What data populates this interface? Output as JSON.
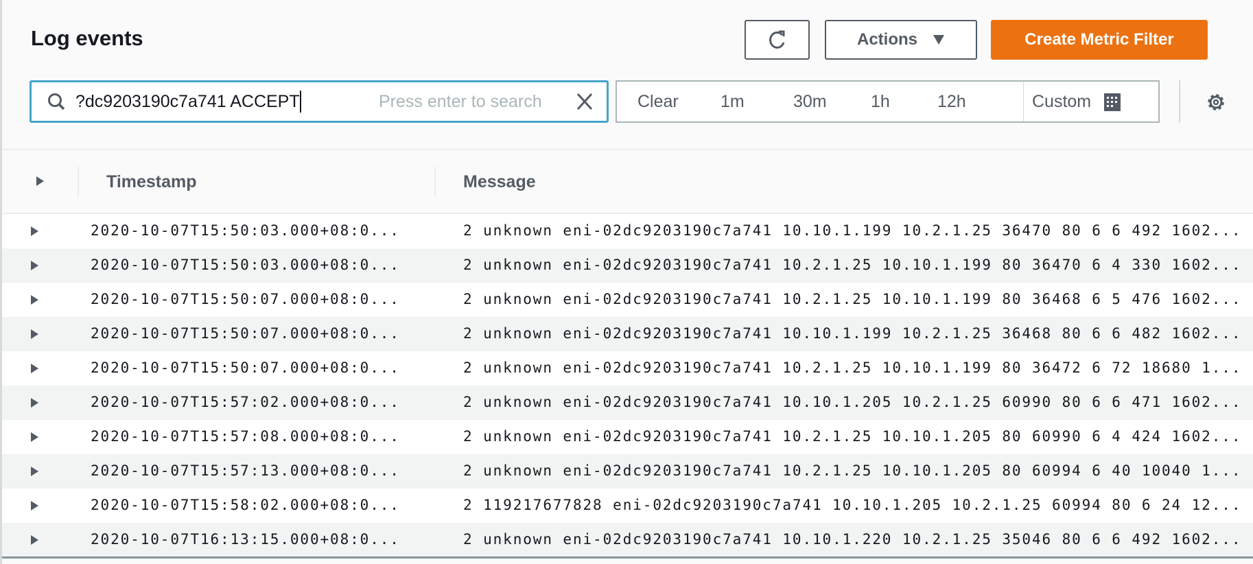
{
  "header": {
    "title": "Log events",
    "refresh_icon": "refresh-icon",
    "actions_label": "Actions",
    "create_metric_filter_label": "Create Metric Filter",
    "accent_color": "#ec7211"
  },
  "search": {
    "value": "2dc9203190c7a741 ACCEPT",
    "visible_value": "?dc9203190c7a741 ACCEPT",
    "placeholder": "Press enter to search"
  },
  "time_range": {
    "options": [
      "Clear",
      "1m",
      "30m",
      "1h",
      "12h"
    ],
    "custom_label": "Custom"
  },
  "table": {
    "columns": [
      "Timestamp",
      "Message"
    ],
    "rows": [
      {
        "timestamp": "2020-10-07T15:50:03.000+08:0...",
        "message": "2 unknown eni-02dc9203190c7a741 10.10.1.199 10.2.1.25 36470 80 6 6 492 1602..."
      },
      {
        "timestamp": "2020-10-07T15:50:03.000+08:0...",
        "message": "2 unknown eni-02dc9203190c7a741 10.2.1.25 10.10.1.199 80 36470 6 4 330 1602..."
      },
      {
        "timestamp": "2020-10-07T15:50:07.000+08:0...",
        "message": "2 unknown eni-02dc9203190c7a741 10.2.1.25 10.10.1.199 80 36468 6 5 476 1602..."
      },
      {
        "timestamp": "2020-10-07T15:50:07.000+08:0...",
        "message": "2 unknown eni-02dc9203190c7a741 10.10.1.199 10.2.1.25 36468 80 6 6 482 1602..."
      },
      {
        "timestamp": "2020-10-07T15:50:07.000+08:0...",
        "message": "2 unknown eni-02dc9203190c7a741 10.2.1.25 10.10.1.199 80 36472 6 72 18680 1..."
      },
      {
        "timestamp": "2020-10-07T15:57:02.000+08:0...",
        "message": "2 unknown eni-02dc9203190c7a741 10.10.1.205 10.2.1.25 60990 80 6 6 471 1602..."
      },
      {
        "timestamp": "2020-10-07T15:57:08.000+08:0...",
        "message": "2 unknown eni-02dc9203190c7a741 10.2.1.25 10.10.1.205 80 60990 6 4 424 1602..."
      },
      {
        "timestamp": "2020-10-07T15:57:13.000+08:0...",
        "message": "2 unknown eni-02dc9203190c7a741 10.2.1.25 10.10.1.205 80 60994 6 40 10040 1..."
      },
      {
        "timestamp": "2020-10-07T15:58:02.000+08:0...",
        "message": "2 119217677828 eni-02dc9203190c7a741 10.10.1.205 10.2.1.25 60994 80 6 24 12..."
      },
      {
        "timestamp": "2020-10-07T16:13:15.000+08:0...",
        "message": "2 unknown eni-02dc9203190c7a741 10.10.1.220 10.2.1.25 35046 80 6 6 492 1602..."
      }
    ]
  }
}
